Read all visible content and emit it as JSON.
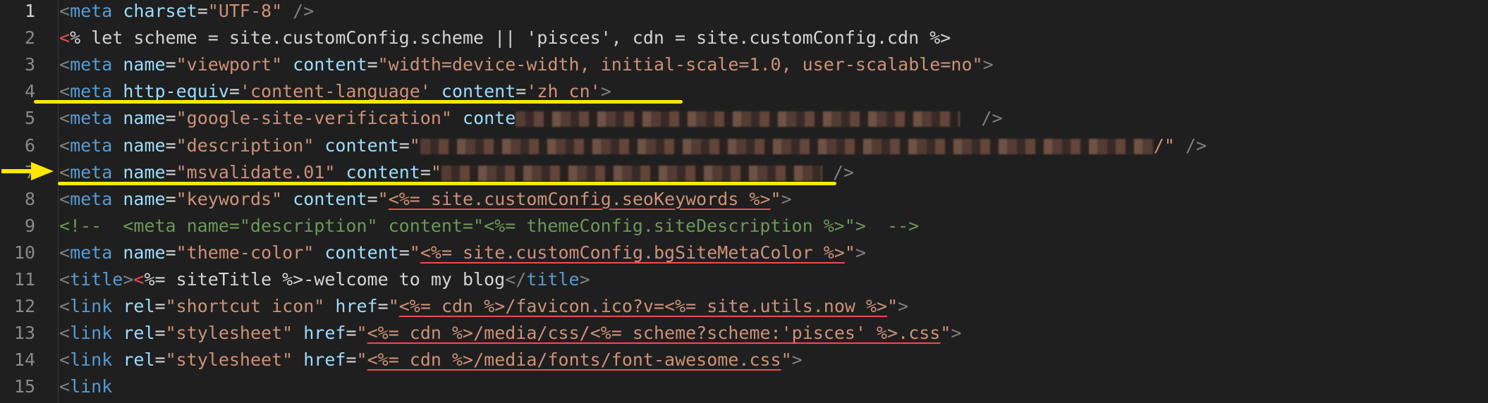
{
  "editor": {
    "lines": [
      {
        "no": "1",
        "segs": [
          {
            "t": "<",
            "c": "tag"
          },
          {
            "t": "meta",
            "c": "tn"
          },
          {
            "t": " ",
            "c": "tx"
          },
          {
            "t": "charset",
            "c": "at"
          },
          {
            "t": "=",
            "c": "tx"
          },
          {
            "t": "\"UTF-8\"",
            "c": "st"
          },
          {
            "t": " />",
            "c": "tag"
          }
        ]
      },
      {
        "no": "2",
        "segs": [
          {
            "t": "<",
            "c": "redlt"
          },
          {
            "t": "% let scheme = site.customConfig.scheme || 'pisces', cdn = site.customConfig.cdn %>",
            "c": "tx"
          }
        ]
      },
      {
        "no": "3",
        "segs": [
          {
            "t": "<",
            "c": "tag"
          },
          {
            "t": "meta",
            "c": "tn"
          },
          {
            "t": " ",
            "c": "tx"
          },
          {
            "t": "name",
            "c": "at"
          },
          {
            "t": "=",
            "c": "tx"
          },
          {
            "t": "\"viewport\"",
            "c": "st"
          },
          {
            "t": " ",
            "c": "tx"
          },
          {
            "t": "content",
            "c": "at"
          },
          {
            "t": "=",
            "c": "tx"
          },
          {
            "t": "\"width=device-width, initial-scale=1.0, user-scalable=no\"",
            "c": "st"
          },
          {
            "t": ">",
            "c": "tag"
          }
        ]
      },
      {
        "no": "4",
        "segs": [
          {
            "t": "<",
            "c": "tag"
          },
          {
            "t": "meta",
            "c": "tn"
          },
          {
            "t": " ",
            "c": "tx"
          },
          {
            "t": "http-equiv",
            "c": "at"
          },
          {
            "t": "=",
            "c": "tx"
          },
          {
            "t": "'content-language'",
            "c": "st"
          },
          {
            "t": " ",
            "c": "tx"
          },
          {
            "t": "content",
            "c": "at"
          },
          {
            "t": "=",
            "c": "tx"
          },
          {
            "t": "'zh_cn'",
            "c": "st"
          },
          {
            "t": ">",
            "c": "tag"
          }
        ]
      },
      {
        "no": "5",
        "segs": [
          {
            "t": "<",
            "c": "tag"
          },
          {
            "t": "meta",
            "c": "tn"
          },
          {
            "t": " ",
            "c": "tx"
          },
          {
            "t": "name",
            "c": "at"
          },
          {
            "t": "=",
            "c": "tx"
          },
          {
            "t": "\"google-site-verification\"",
            "c": "st"
          },
          {
            "t": " ",
            "c": "tx"
          },
          {
            "t": "conte",
            "c": "at"
          },
          {
            "t": "",
            "c": "blur",
            "w": 630
          },
          {
            "t": "  />",
            "c": "tag"
          }
        ]
      },
      {
        "no": "6",
        "segs": [
          {
            "t": "<",
            "c": "tag"
          },
          {
            "t": "meta",
            "c": "tn"
          },
          {
            "t": " ",
            "c": "tx"
          },
          {
            "t": "name",
            "c": "at"
          },
          {
            "t": "=",
            "c": "tx"
          },
          {
            "t": "\"description\"",
            "c": "st"
          },
          {
            "t": " ",
            "c": "tx"
          },
          {
            "t": "content",
            "c": "at"
          },
          {
            "t": "=",
            "c": "tx"
          },
          {
            "t": "\"",
            "c": "st"
          },
          {
            "t": "",
            "c": "blur",
            "w": 1040
          },
          {
            "t": "/\"",
            "c": "st"
          },
          {
            "t": " />",
            "c": "tag"
          }
        ]
      },
      {
        "no": "7",
        "segs": [
          {
            "t": "<",
            "c": "tag"
          },
          {
            "t": "meta",
            "c": "tn"
          },
          {
            "t": " ",
            "c": "tx"
          },
          {
            "t": "name",
            "c": "at"
          },
          {
            "t": "=",
            "c": "tx"
          },
          {
            "t": "\"msvalidate.01\"",
            "c": "st"
          },
          {
            "t": " ",
            "c": "tx"
          },
          {
            "t": "content",
            "c": "at"
          },
          {
            "t": "=",
            "c": "tx"
          },
          {
            "t": "\"",
            "c": "st"
          },
          {
            "t": "",
            "c": "blur",
            "w": 540
          },
          {
            "t": " />",
            "c": "tag"
          }
        ]
      },
      {
        "no": "8",
        "segs": [
          {
            "t": "<",
            "c": "tag"
          },
          {
            "t": "meta",
            "c": "tn"
          },
          {
            "t": " ",
            "c": "tx"
          },
          {
            "t": "name",
            "c": "at"
          },
          {
            "t": "=",
            "c": "tx"
          },
          {
            "t": "\"keywords\"",
            "c": "st"
          },
          {
            "t": " ",
            "c": "tx"
          },
          {
            "t": "content",
            "c": "at"
          },
          {
            "t": "=",
            "c": "tx"
          },
          {
            "t": "\"",
            "c": "st"
          },
          {
            "t": "<%= site.customConfig.seoKeywords %>",
            "c": "ej err"
          },
          {
            "t": "\"",
            "c": "st"
          },
          {
            "t": ">",
            "c": "tag"
          }
        ]
      },
      {
        "no": "9",
        "segs": [
          {
            "t": "<!--  <meta name=\"description\" content=\"<%= themeConfig.siteDescription %>\">  -->",
            "c": "cm"
          }
        ]
      },
      {
        "no": "10",
        "segs": [
          {
            "t": "<",
            "c": "tag"
          },
          {
            "t": "meta",
            "c": "tn"
          },
          {
            "t": " ",
            "c": "tx"
          },
          {
            "t": "name",
            "c": "at"
          },
          {
            "t": "=",
            "c": "tx"
          },
          {
            "t": "\"theme-color\"",
            "c": "st"
          },
          {
            "t": " ",
            "c": "tx"
          },
          {
            "t": "content",
            "c": "at"
          },
          {
            "t": "=",
            "c": "tx"
          },
          {
            "t": "\"",
            "c": "st"
          },
          {
            "t": "<%= site.customConfig.bgSiteMetaColor %>",
            "c": "ej err"
          },
          {
            "t": "\"",
            "c": "st"
          },
          {
            "t": ">",
            "c": "tag"
          }
        ]
      },
      {
        "no": "11",
        "segs": [
          {
            "t": "<",
            "c": "tag"
          },
          {
            "t": "title",
            "c": "tn"
          },
          {
            "t": ">",
            "c": "tag"
          },
          {
            "t": "<",
            "c": "redlt"
          },
          {
            "t": "%= siteTitle %>-welcome to my blog",
            "c": "tx"
          },
          {
            "t": "</",
            "c": "tag"
          },
          {
            "t": "title",
            "c": "tn"
          },
          {
            "t": ">",
            "c": "tag"
          }
        ]
      },
      {
        "no": "12",
        "segs": [
          {
            "t": "<",
            "c": "tag"
          },
          {
            "t": "link",
            "c": "tn"
          },
          {
            "t": " ",
            "c": "tx"
          },
          {
            "t": "rel",
            "c": "at"
          },
          {
            "t": "=",
            "c": "tx"
          },
          {
            "t": "\"shortcut icon\"",
            "c": "st"
          },
          {
            "t": " ",
            "c": "tx"
          },
          {
            "t": "href",
            "c": "at"
          },
          {
            "t": "=",
            "c": "tx"
          },
          {
            "t": "\"",
            "c": "st"
          },
          {
            "t": "<%= cdn %>/favicon.ico?v=<%= site.utils.now %>",
            "c": "ej err"
          },
          {
            "t": "\"",
            "c": "st"
          },
          {
            "t": ">",
            "c": "tag"
          }
        ]
      },
      {
        "no": "13",
        "segs": [
          {
            "t": "<",
            "c": "tag"
          },
          {
            "t": "link",
            "c": "tn"
          },
          {
            "t": " ",
            "c": "tx"
          },
          {
            "t": "rel",
            "c": "at"
          },
          {
            "t": "=",
            "c": "tx"
          },
          {
            "t": "\"stylesheet\"",
            "c": "st"
          },
          {
            "t": " ",
            "c": "tx"
          },
          {
            "t": "href",
            "c": "at"
          },
          {
            "t": "=",
            "c": "tx"
          },
          {
            "t": "\"",
            "c": "st"
          },
          {
            "t": "<%= cdn %>/media/css/<%= scheme?scheme:'pisces' %>.css",
            "c": "ej err"
          },
          {
            "t": "\"",
            "c": "st"
          },
          {
            "t": ">",
            "c": "tag"
          }
        ]
      },
      {
        "no": "14",
        "segs": [
          {
            "t": "<",
            "c": "tag"
          },
          {
            "t": "link",
            "c": "tn"
          },
          {
            "t": " ",
            "c": "tx"
          },
          {
            "t": "rel",
            "c": "at"
          },
          {
            "t": "=",
            "c": "tx"
          },
          {
            "t": "\"stylesheet\"",
            "c": "st"
          },
          {
            "t": " ",
            "c": "tx"
          },
          {
            "t": "href",
            "c": "at"
          },
          {
            "t": "=",
            "c": "tx"
          },
          {
            "t": "\"",
            "c": "st"
          },
          {
            "t": "<%= cdn %>/media/fonts/font-awesome.css",
            "c": "ej err"
          },
          {
            "t": "\"",
            "c": "st"
          },
          {
            "t": ">",
            "c": "tag"
          }
        ]
      },
      {
        "no": "15",
        "segs": [
          {
            "t": "<",
            "c": "tag"
          },
          {
            "t": "link",
            "c": "tn"
          }
        ]
      }
    ],
    "active_line": "1"
  },
  "annotations": {
    "highlight_color": "#ffe800",
    "arrow_icon": "arrow-right-icon",
    "highlighted_lines": [
      "4",
      "7"
    ],
    "arrow_line": "7"
  }
}
